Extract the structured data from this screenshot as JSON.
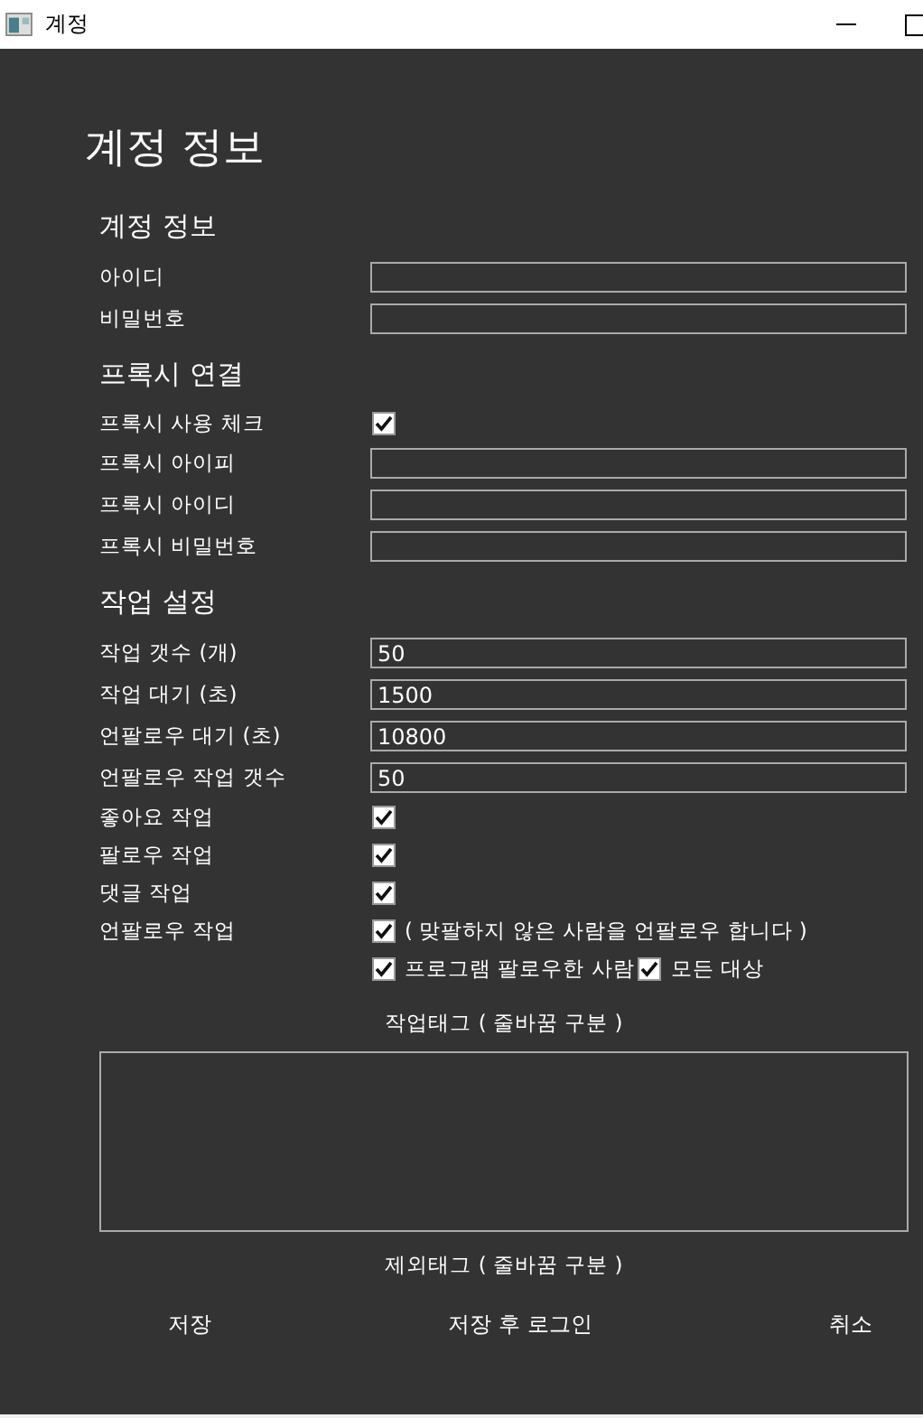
{
  "window": {
    "title": "계정"
  },
  "heading": "계정 정보",
  "sections": [
    {
      "title": "계정 정보",
      "rows": [
        {
          "kind": "field",
          "label": "아이디"
        },
        {
          "kind": "field",
          "label": "비밀번호"
        }
      ]
    },
    {
      "title": "프록시 연결",
      "rows": [
        {
          "kind": "check",
          "label": "프록시 사용 체크",
          "checked": true
        },
        {
          "kind": "field",
          "label": "프록시 아이피"
        },
        {
          "kind": "field",
          "label": "프록시 아이디"
        },
        {
          "kind": "field",
          "label": "프록시 비밀번호"
        }
      ]
    },
    {
      "title": "작업 설정",
      "rows": [
        {
          "kind": "field",
          "label": "작업 갯수 (개)",
          "value": "50"
        },
        {
          "kind": "field",
          "label": "작업 대기 (초)",
          "value": "1500"
        },
        {
          "kind": "field",
          "label": "언팔로우 대기 (초)",
          "value": "10800"
        },
        {
          "kind": "field",
          "label": "언팔로우 작업 갯수",
          "value": "50"
        },
        {
          "kind": "check",
          "label": "좋아요 작업",
          "checked": true
        },
        {
          "kind": "check",
          "label": "팔로우 작업",
          "checked": true
        },
        {
          "kind": "check",
          "label": "댓글 작업",
          "checked": true
        },
        {
          "kind": "check",
          "label": "언팔로우 작업",
          "checked": true,
          "note": "( 맞팔하지 않은 사람을 언팔로우 합니다 )"
        },
        {
          "kind": "options",
          "options": [
            {
              "label": "프로그램 팔로우한 사람",
              "checked": true
            },
            {
              "label": "모든 대상",
              "checked": true
            }
          ]
        }
      ]
    }
  ],
  "tags": [
    {
      "label": "작업태그 ( 줄바꿈 구분 )",
      "kind": "textarea"
    },
    {
      "label": "제외태그 ( 줄바꿈 구분 )",
      "kind": "label"
    }
  ],
  "buttons": [
    "저장",
    "저장 후 로그인",
    "취소"
  ]
}
